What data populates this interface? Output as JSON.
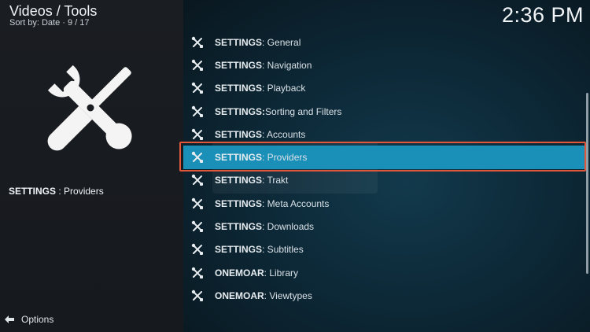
{
  "header": {
    "title": "Videos / Tools",
    "sort_label": "Sort by: Date",
    "position": "9 / 17",
    "clock": "2:36 PM"
  },
  "left_panel": {
    "selected_strong": "SETTINGS",
    "selected_rest": " : Providers",
    "big_icon": "tools-icon"
  },
  "footer": {
    "options_label": "Options",
    "options_icon": "options-arrows-icon"
  },
  "menu": {
    "items": [
      {
        "strong": "SETTINGS",
        "rest": " : General"
      },
      {
        "strong": "SETTINGS",
        "rest": " : Navigation"
      },
      {
        "strong": "SETTINGS",
        "rest": " : Playback"
      },
      {
        "strong": "SETTINGS:",
        "rest": " Sorting and Filters"
      },
      {
        "strong": "SETTINGS",
        "rest": " : Accounts"
      },
      {
        "strong": "SETTINGS",
        "rest": " : Providers"
      },
      {
        "strong": "SETTINGS",
        "rest": " : Trakt"
      },
      {
        "strong": "SETTINGS",
        "rest": " : Meta Accounts"
      },
      {
        "strong": "SETTINGS",
        "rest": " : Downloads"
      },
      {
        "strong": "SETTINGS",
        "rest": " : Subtitles"
      },
      {
        "strong": "ONEMOAR",
        "rest": " : Library"
      },
      {
        "strong": "ONEMOAR",
        "rest": " : Viewtypes"
      }
    ],
    "focused_index": 5,
    "item_icon": "tools-icon"
  },
  "colors": {
    "focus_fill": "#1a8fb8",
    "focus_outline": "#e0573c"
  }
}
